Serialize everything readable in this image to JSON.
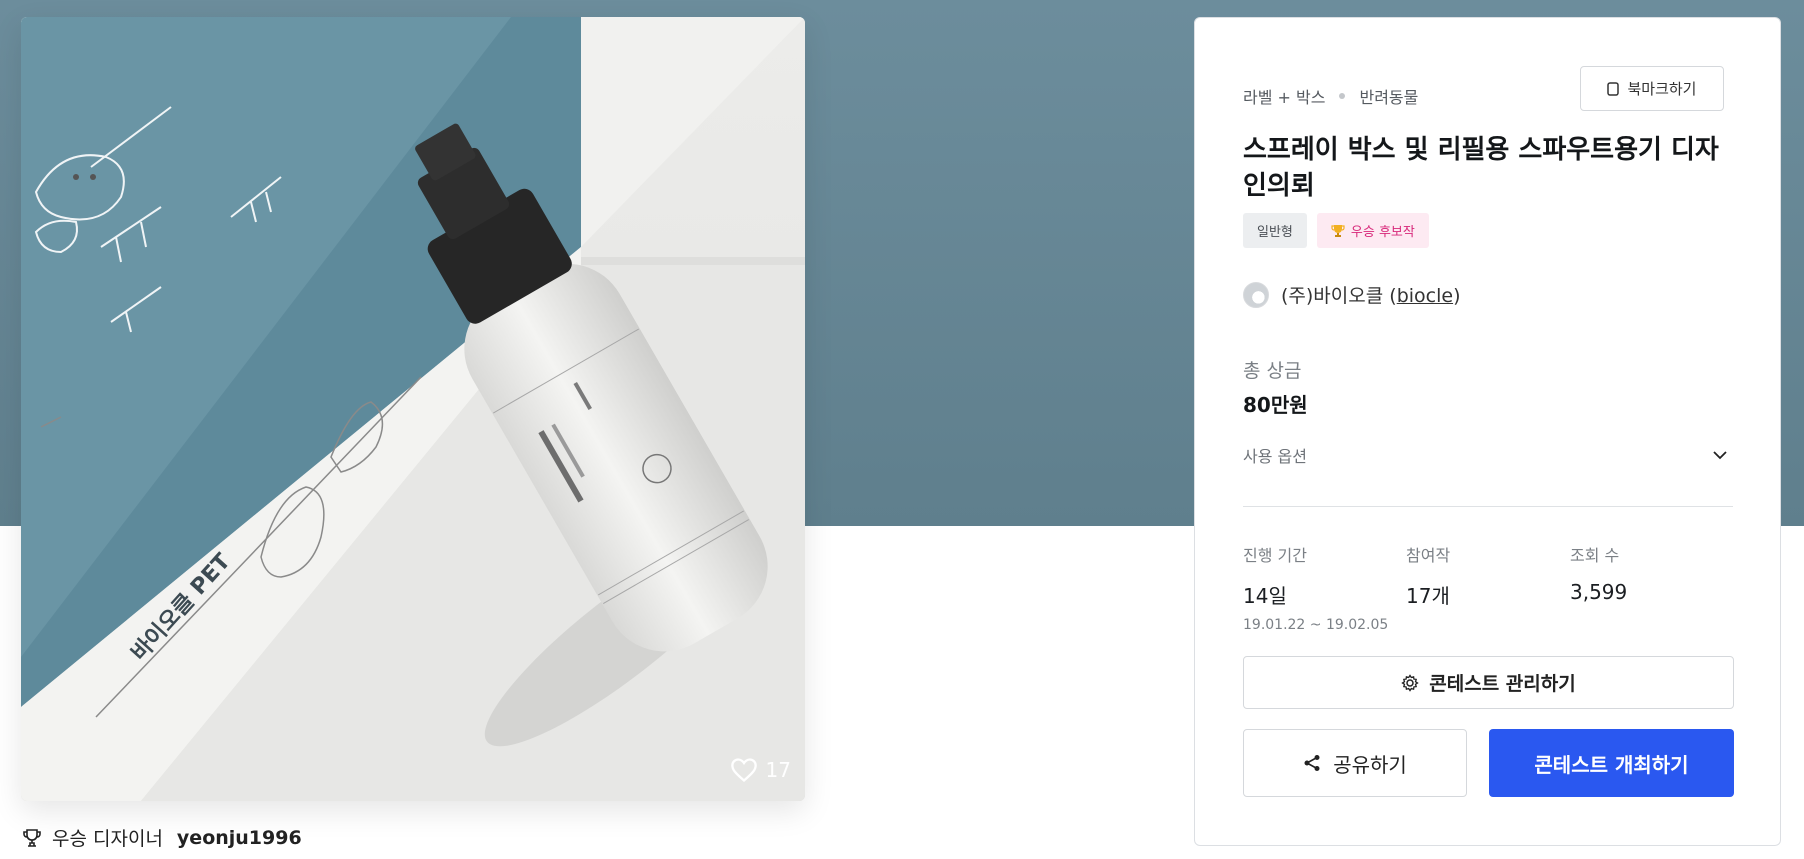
{
  "image": {
    "likes": "17",
    "box_text": "바이오클 PET"
  },
  "winner": {
    "label": "우승 디자이너",
    "name": "yeonju1996"
  },
  "panel": {
    "breadcrumb": [
      "라벨 + 박스",
      "반려동물"
    ],
    "bookmark_label": "북마크하기",
    "title": "스프레이 박스 및 리필용 스파우트용기 디자인의뢰",
    "tags": {
      "type": "일반형",
      "award": "우승 후보작"
    },
    "host": {
      "name": "(주)바이오클 (",
      "id": "biocle",
      "suffix": ")"
    },
    "prize": {
      "label": "총 상금",
      "value": "80만원"
    },
    "options_label": "사용 옵션",
    "stats": {
      "period": {
        "label": "진행 기간",
        "value": "14일",
        "dates": "19.01.22 ~ 19.02.05"
      },
      "entries": {
        "label": "참여작",
        "value": "17개"
      },
      "views": {
        "label": "조회 수",
        "value": "3,599"
      }
    },
    "manage_label": "콘테스트 관리하기",
    "share_label": "공유하기",
    "host_contest_label": "콘테스트 개최하기"
  },
  "colors": {
    "hero": "#6c8d9c",
    "primary": "#2a58f0",
    "award_text": "#d8287a",
    "award_bg": "#fdeaf2"
  }
}
